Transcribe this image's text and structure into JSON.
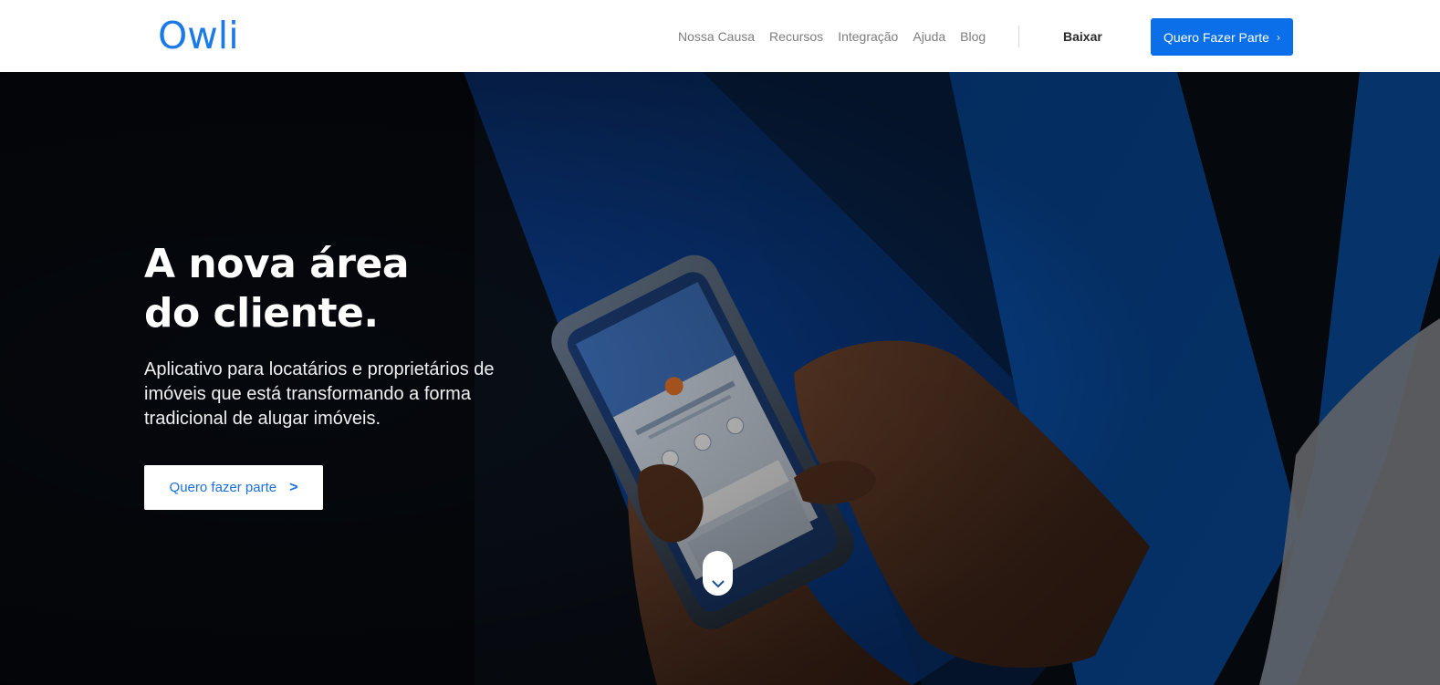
{
  "header": {
    "logo_text": "Owli",
    "nav": [
      "Nossa Causa",
      "Recursos",
      "Integração",
      "Ajuda",
      "Blog"
    ],
    "download_label": "Baixar",
    "cta_label": "Quero Fazer Parte"
  },
  "hero": {
    "title_line1": "A nova área",
    "title_line2": "do cliente.",
    "subtitle": "Aplicativo para locatários e proprietários de imóveis que está transformando a forma tradicional de alugar imóveis.",
    "button_label": "Quero fazer parte"
  },
  "icons": {
    "nav_cta_chevron": "chevron-right-icon",
    "hero_button_chevron": "chevron-right-icon",
    "scroll_indicator": "chevron-down-icon"
  },
  "colors": {
    "brand_blue": "#1a7ae8",
    "cta_blue": "#0a6fe8",
    "hero_blue_band": "#0a6be0"
  }
}
